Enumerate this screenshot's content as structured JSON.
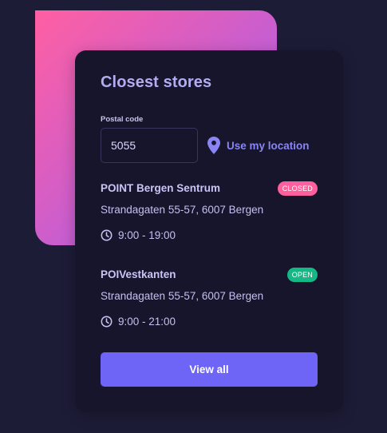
{
  "card": {
    "title": "Closest stores",
    "postal_label": "Postal code",
    "postal_value": "5055",
    "location_link": "Use my location",
    "view_all_label": "View all"
  },
  "stores": [
    {
      "name": "POINT Bergen Sentrum",
      "status": "CLOSED",
      "address": "Strandagaten 55-57, 6007 Bergen",
      "hours": "9:00 - 19:00"
    },
    {
      "name": "POIVestkanten",
      "status": "OPEN",
      "address": "Strandagaten 55-57, 6007 Bergen",
      "hours": "9:00 - 21:00"
    }
  ],
  "colors": {
    "background": "#1d1c37",
    "card": "#16152b",
    "accent": "#6e64f5",
    "closed_badge": "#ff5f9d",
    "open_badge": "#14b885"
  },
  "icons": {
    "location": "map-pin-icon",
    "hours": "clock-icon"
  }
}
